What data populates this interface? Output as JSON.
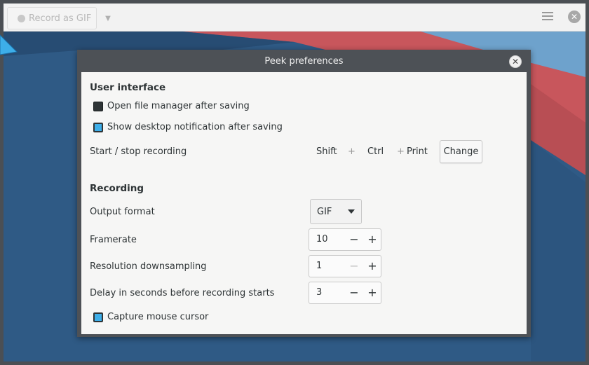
{
  "app": {
    "record_button_label": "Record as GIF",
    "menu_icon": "hamburger-menu-icon",
    "close_icon": "close-icon"
  },
  "dialog": {
    "title": "Peek preferences",
    "user_interface": {
      "heading": "User interface",
      "open_file_manager": {
        "label": "Open file manager after saving",
        "checked": false
      },
      "show_notification": {
        "label": "Show desktop notification after saving",
        "checked": true
      },
      "shortcut": {
        "label": "Start / stop recording",
        "keys": [
          "Shift",
          "Ctrl",
          "Print"
        ],
        "separator": "+",
        "change_label": "Change"
      }
    },
    "recording": {
      "heading": "Recording",
      "output_format": {
        "label": "Output format",
        "value": "GIF"
      },
      "framerate": {
        "label": "Framerate",
        "value": "10",
        "minus": "−",
        "plus": "+"
      },
      "downsampling": {
        "label": "Resolution downsampling",
        "value": "1",
        "minus": "−",
        "plus": "+"
      },
      "delay": {
        "label": "Delay in seconds before recording starts",
        "value": "3",
        "minus": "−",
        "plus": "+"
      },
      "capture_cursor": {
        "label": "Capture mouse cursor",
        "checked": true
      }
    }
  },
  "colors": {
    "accent": "#3daee9",
    "dialog_frame": "#4d5156",
    "wallpaper_blue": "#2f5a85",
    "wallpaper_red": "#c8565c"
  }
}
